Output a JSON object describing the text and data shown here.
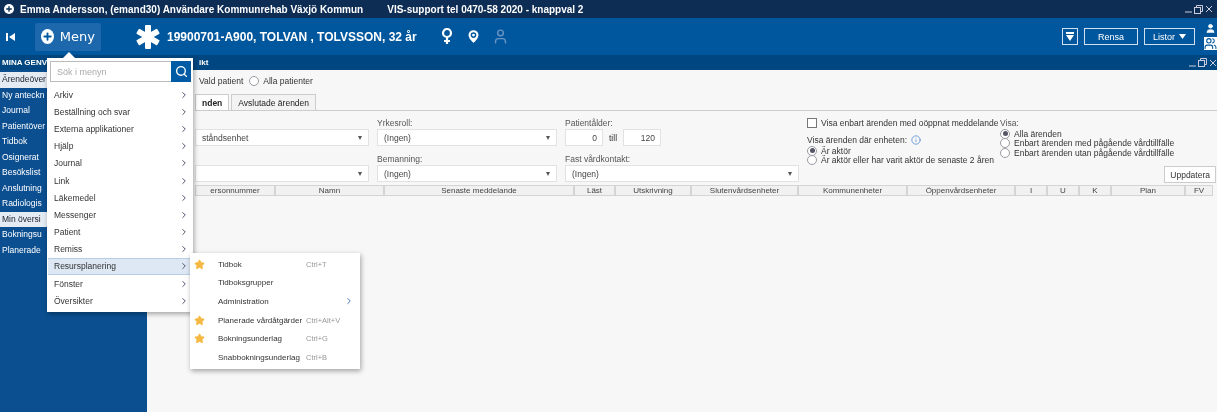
{
  "title_bar": {
    "user": "Emma  Andersson, (emand30) Användare Kommunrehab Växjö Kommun",
    "support": "VIS-support tel 0470-58 2020  - knappval 2"
  },
  "header": {
    "menu_button": "Meny",
    "patient": "19900701-A900,  TOLVAN , TOLVSSON,  32 år",
    "buttons": [
      "Rensa",
      "Listor"
    ]
  },
  "subheader": {
    "section": "MINA GENV",
    "tab": "ikt"
  },
  "sidebar": {
    "items": [
      {
        "label": "Ärendeöver",
        "selected": true
      },
      {
        "label": "Ny anteckn",
        "selected": false
      },
      {
        "label": "Journal",
        "selected": false
      },
      {
        "label": "Patientöver",
        "selected": false
      },
      {
        "label": "Tidbok",
        "selected": false
      },
      {
        "label": "Osignerat",
        "selected": false
      },
      {
        "label": "Besökslist",
        "selected": false
      },
      {
        "label": "Anslutning",
        "selected": false
      },
      {
        "label": "Radiologis",
        "selected": false
      },
      {
        "label": "Min översi",
        "selected": true
      },
      {
        "label": "Bokningsu",
        "selected": false
      },
      {
        "label": "Planerade",
        "selected": false
      }
    ]
  },
  "menu": {
    "search_placeholder": "Sök i menyn",
    "items": [
      {
        "label": "Arkiv",
        "selected": false
      },
      {
        "label": "Beställning och svar",
        "selected": false
      },
      {
        "label": "Externa applikationer",
        "selected": false
      },
      {
        "label": "Hjälp",
        "selected": false
      },
      {
        "label": "Journal",
        "selected": false
      },
      {
        "label": "Link",
        "selected": false
      },
      {
        "label": "Läkemedel",
        "selected": false
      },
      {
        "label": "Messenger",
        "selected": false
      },
      {
        "label": "Patient",
        "selected": false
      },
      {
        "label": "Remiss",
        "selected": false
      },
      {
        "label": "Resursplanering",
        "selected": true
      },
      {
        "label": "Fönster",
        "selected": false
      },
      {
        "label": "Översikter",
        "selected": false
      }
    ],
    "submenu": [
      {
        "kind": "command",
        "label": "Tidbok",
        "favorite": true,
        "shortcut": "Ctrl+T"
      },
      {
        "kind": "command",
        "label": "Tidboksgrupper",
        "favorite": false
      },
      {
        "kind": "submenu",
        "label": "Administration",
        "favorite": false
      },
      {
        "kind": "command",
        "label": "Planerade vårdåtgärder",
        "favorite": true,
        "shortcut": "Ctrl+Alt+V"
      },
      {
        "kind": "command",
        "label": "Bokningsunderlag",
        "favorite": true,
        "shortcut": "Ctrl+G"
      },
      {
        "kind": "command",
        "label": "Snabbokningsunderlag",
        "favorite": false,
        "shortcut": "Ctrl+B"
      }
    ]
  },
  "main": {
    "scope_text": "Vald patient",
    "scope_options": [
      {
        "label": "Alla patienter",
        "selected": false
      }
    ],
    "tabs": [
      {
        "label": "nden",
        "selected": true
      },
      {
        "label": "Avslutade ärenden",
        "selected": false
      }
    ],
    "unit_select": "ståndsenhet",
    "fields": [
      {
        "label": "Yrkesroll:",
        "value": "(Ingen)"
      },
      {
        "label": "Bemanning:",
        "value": "(Ingen)"
      }
    ],
    "age": {
      "label": "Patientålder:",
      "from": "0",
      "separator": "till",
      "to": "120"
    },
    "contact": {
      "label": "Fast vårdkontakt:",
      "value": "(Ingen)"
    },
    "unread": {
      "label": "Visa enbart ärenden med oöppnat meddelande",
      "checked": false
    },
    "unit_filter": {
      "label": "Visa ärenden där enheten:",
      "options": [
        {
          "label": "Är aktör",
          "selected": true
        },
        {
          "label": "Är aktör eller har varit aktör de senaste 2 åren",
          "selected": false
        }
      ]
    },
    "show": {
      "label": "Visa:",
      "options": [
        {
          "label": "Alla ärenden",
          "selected": true
        },
        {
          "label": "Enbart ärenden med pågående vårdtillfälle",
          "selected": false
        },
        {
          "label": "Enbart ärenden utan pågående vårdtillfälle",
          "selected": false
        }
      ]
    },
    "update_button": "Uppdatera",
    "table": {
      "columns": [
        "ersonnummer",
        "Namn",
        "Senaste meddelande",
        "Läst",
        "Utskrivning",
        "Slutenvårdsenheter",
        "Kommunenheter",
        "Öppenvårdsenheter",
        "I",
        "U",
        "K",
        "Plan",
        "FV"
      ]
    }
  }
}
